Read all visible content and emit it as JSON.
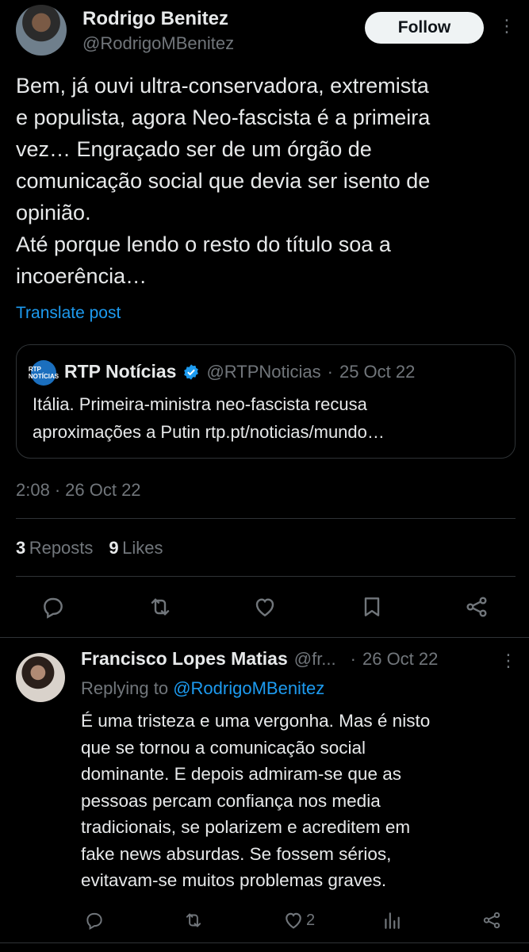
{
  "post": {
    "author_name": "Rodrigo Benitez",
    "author_handle": "@RodrigoMBenitez",
    "follow_label": "Follow",
    "more_glyph": "⋮",
    "text": "Bem, já ouvi ultra-conservadora, extremista\ne populista, agora Neo-fascista é a primeira\nvez… Engraçado ser de um órgão de\ncomunicação social que devia ser isento de\nopinião.\nAté porque lendo o resto do título soa a\nincoerência…",
    "translate_label": "Translate post",
    "quote": {
      "logo_text": "RTP NOTÍCIAS",
      "name": "RTP Notícias",
      "handle": "@RTPNoticias",
      "sep": "·",
      "date": "25 Oct 22",
      "text": "Itália. Primeira-ministra neo-fascista recusa\naproximações a Putin rtp.pt/noticias/mundo…"
    },
    "time": "2:08",
    "sep": "·",
    "date": "26 Oct 22",
    "reposts_count": "3",
    "reposts_label": "Reposts",
    "likes_count": "9",
    "likes_label": "Likes",
    "actions": [
      "reply-icon",
      "repost-icon",
      "like-icon",
      "bookmark-icon",
      "share-icon"
    ]
  },
  "reply": {
    "author_name": "Francisco Lopes Matias",
    "author_handle": "@fr...",
    "sep": "·",
    "date": "26 Oct 22",
    "more_glyph": "⋮",
    "replying_prefix": "Replying to",
    "replying_handle": "@RodrigoMBenitez",
    "text": "É uma tristeza e uma vergonha. Mas é nisto\nque se tornou a comunicação social\ndominante. E depois admiram-se que as\npessoas percam confiança nos media\ntradicionais, se polarizem e acreditem em\nfake news absurdas. Se fossem sérios,\nevitavam-se muitos problemas graves.",
    "like_count": "2",
    "actions": [
      "reply-icon",
      "repost-icon",
      "like-icon",
      "views-icon",
      "share-icon"
    ]
  },
  "colors": {
    "background": "#000000",
    "text": "#e7e9ea",
    "muted": "#71767b",
    "accent": "#1d9bf0",
    "divider": "#2f3336",
    "verified": "#1d9bf0"
  }
}
